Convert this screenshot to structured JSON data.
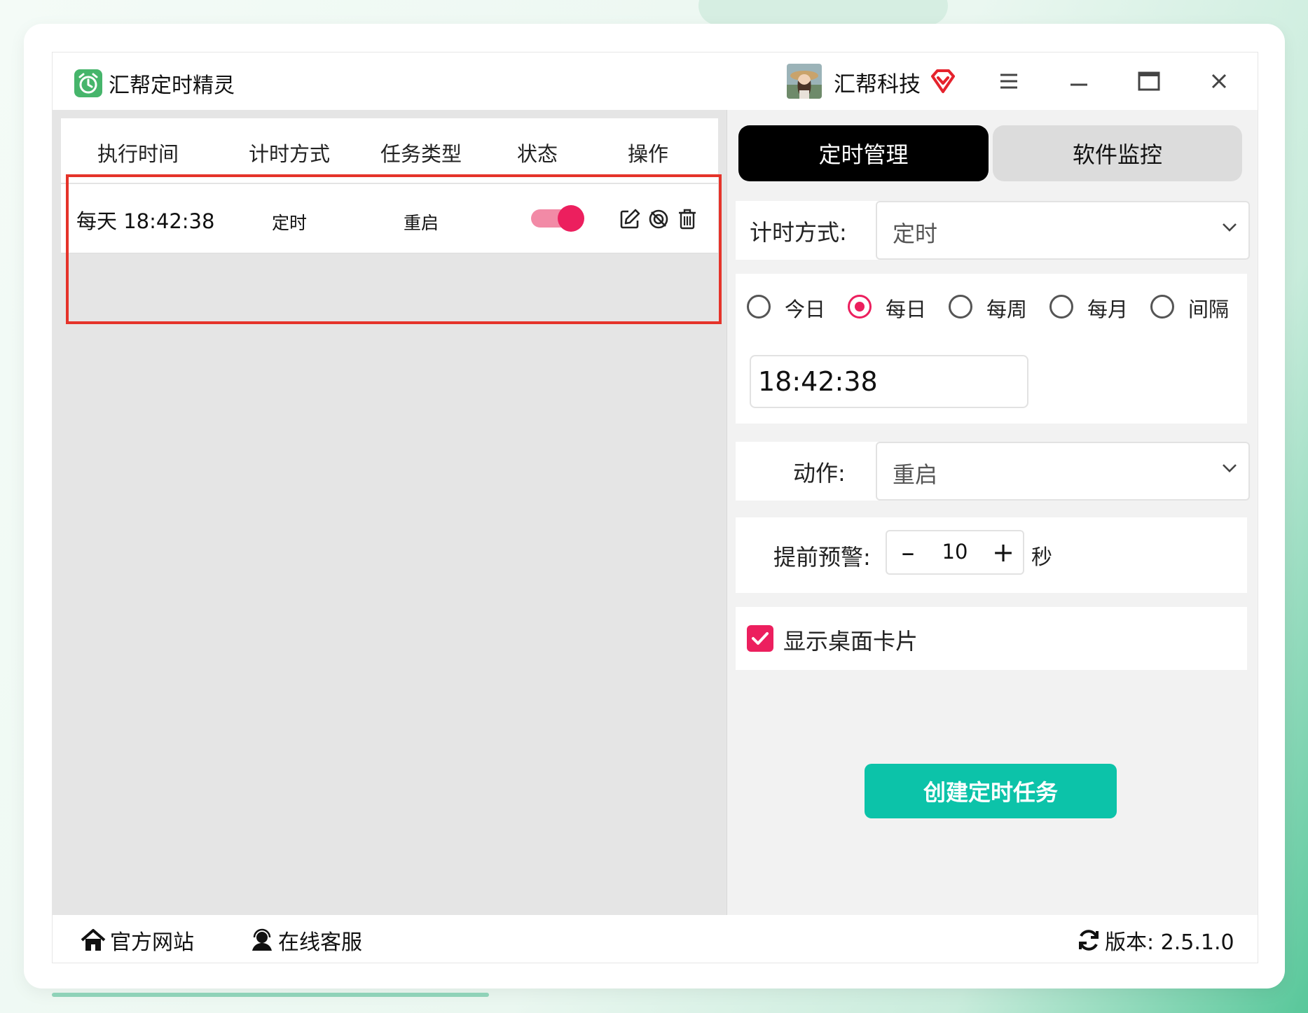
{
  "app": {
    "title": "汇帮定时精灵",
    "company": "汇帮科技",
    "icons": {
      "app": "alarm-clock-icon",
      "vip": "vip-diamond-icon",
      "menu": "menu-icon",
      "minimize": "minimize-icon",
      "maximize": "maximize-icon",
      "close": "close-icon"
    }
  },
  "table": {
    "headers": [
      "执行时间",
      "计时方式",
      "任务类型",
      "状态",
      "操作"
    ],
    "rows": [
      {
        "exec_time": "每天 18:42:38",
        "timing_mode": "定时",
        "task_type": "重启",
        "status_enabled": true,
        "actions": [
          "edit-icon",
          "disable-icon",
          "delete-icon"
        ]
      }
    ]
  },
  "tabs": {
    "active": "定时管理",
    "inactive": "软件监控"
  },
  "form": {
    "timing_label": "计时方式:",
    "timing_value": "定时",
    "frequency_options": [
      "今日",
      "每日",
      "每周",
      "每月",
      "间隔"
    ],
    "frequency_selected": "每日",
    "time_value": "18:42:38",
    "action_label": "动作:",
    "action_value": "重启",
    "warning_label": "提前预警:",
    "warning_minus": "–",
    "warning_value": "10",
    "warning_plus": "+",
    "warning_unit": "秒",
    "show_card_label": "显示桌面卡片",
    "show_card_checked": true,
    "create_button": "创建定时任务"
  },
  "footer": {
    "website": "官方网站",
    "support": "在线客服",
    "version": "版本: 2.5.1.0"
  },
  "colors": {
    "accent": "#ec1f5e",
    "primary_button": "#0cc3a9",
    "highlight_box": "#e5332a"
  }
}
